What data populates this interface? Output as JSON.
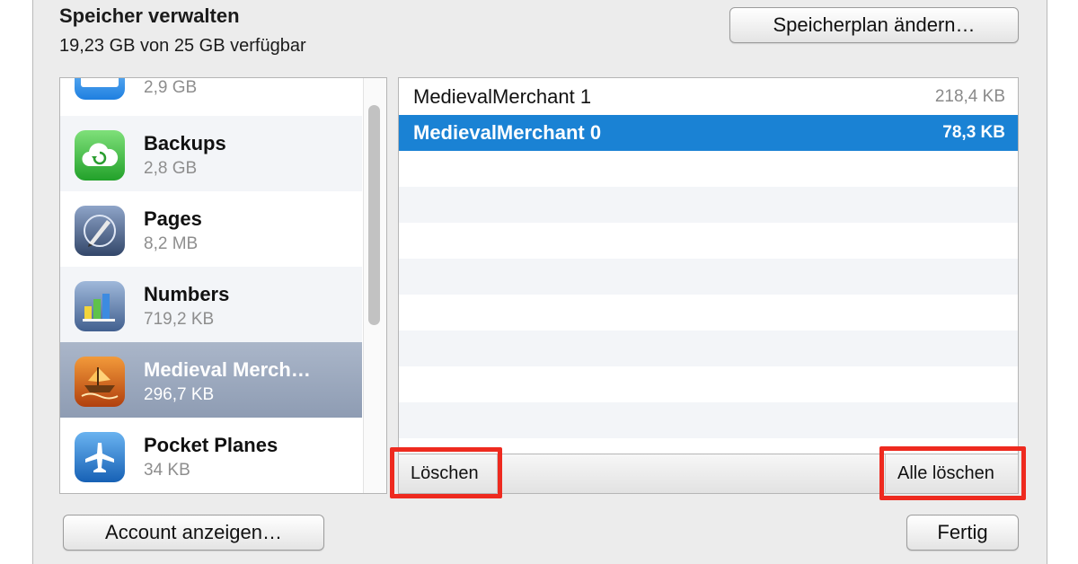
{
  "header": {
    "title": "Speicher verwalten",
    "subtitle": "19,23 GB von 25 GB verfügbar",
    "plan_button": "Speicherplan ändern…"
  },
  "apps": [
    {
      "name": "",
      "size": "2,9 GB",
      "icon": "mail-icon"
    },
    {
      "name": "Backups",
      "size": "2,8 GB",
      "icon": "icloud-backup-icon"
    },
    {
      "name": "Pages",
      "size": "8,2 MB",
      "icon": "pages-icon"
    },
    {
      "name": "Numbers",
      "size": "719,2 KB",
      "icon": "numbers-icon"
    },
    {
      "name": "Medieval Merch…",
      "size": "296,7 KB",
      "icon": "medieval-merchant-icon",
      "selected": true
    },
    {
      "name": "Pocket Planes",
      "size": "34 KB",
      "icon": "pocket-planes-icon"
    }
  ],
  "files": [
    {
      "name": "MedievalMerchant 1",
      "size": "218,4 KB"
    },
    {
      "name": "MedievalMerchant 0",
      "size": "78,3 KB",
      "selected": true
    }
  ],
  "file_actions": {
    "delete": "Löschen",
    "delete_all": "Alle löschen"
  },
  "footer": {
    "account_button": "Account anzeigen…",
    "done_button": "Fertig"
  },
  "colors": {
    "selection_blue": "#1a82d4",
    "selection_gray": "#8e9cb3",
    "highlight_red": "#ee2a1f"
  }
}
